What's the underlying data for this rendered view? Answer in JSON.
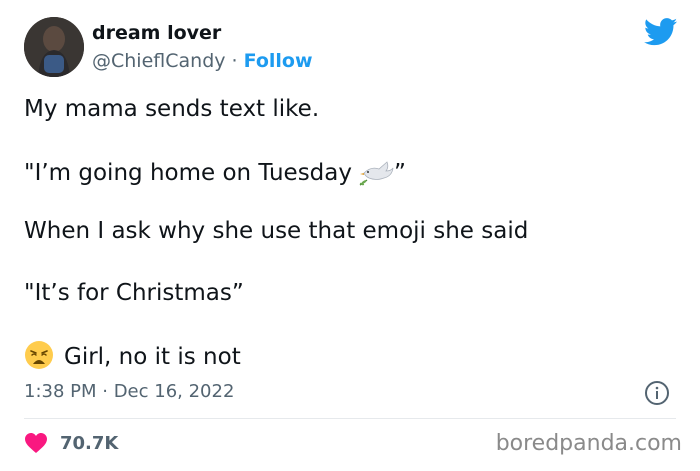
{
  "author": {
    "name": "dream lover",
    "handle": "@ChieflCandy",
    "separator": " · ",
    "follow_label": "Follow"
  },
  "tweet": {
    "lines": [
      "My mama sends text like.",
      "\"I’m going home on Tuesday",
      "When I ask why she use that emoji she said",
      "\"It’s for Christmas”",
      "Girl, no it is not"
    ],
    "line2_close_quote": "”",
    "timestamp": "1:38 PM · Dec 16, 2022"
  },
  "engagement": {
    "like_count": "70.7K"
  },
  "watermark": "boredpanda.com",
  "icons": {
    "brand": "twitter-bird-icon",
    "dove": "dove-emoji",
    "weary": "weary-face-emoji",
    "info": "info-icon",
    "heart": "heart-icon"
  },
  "colors": {
    "twitter_blue": "#1d9bf0",
    "heart_red": "#f91880",
    "muted_text": "#536471"
  }
}
